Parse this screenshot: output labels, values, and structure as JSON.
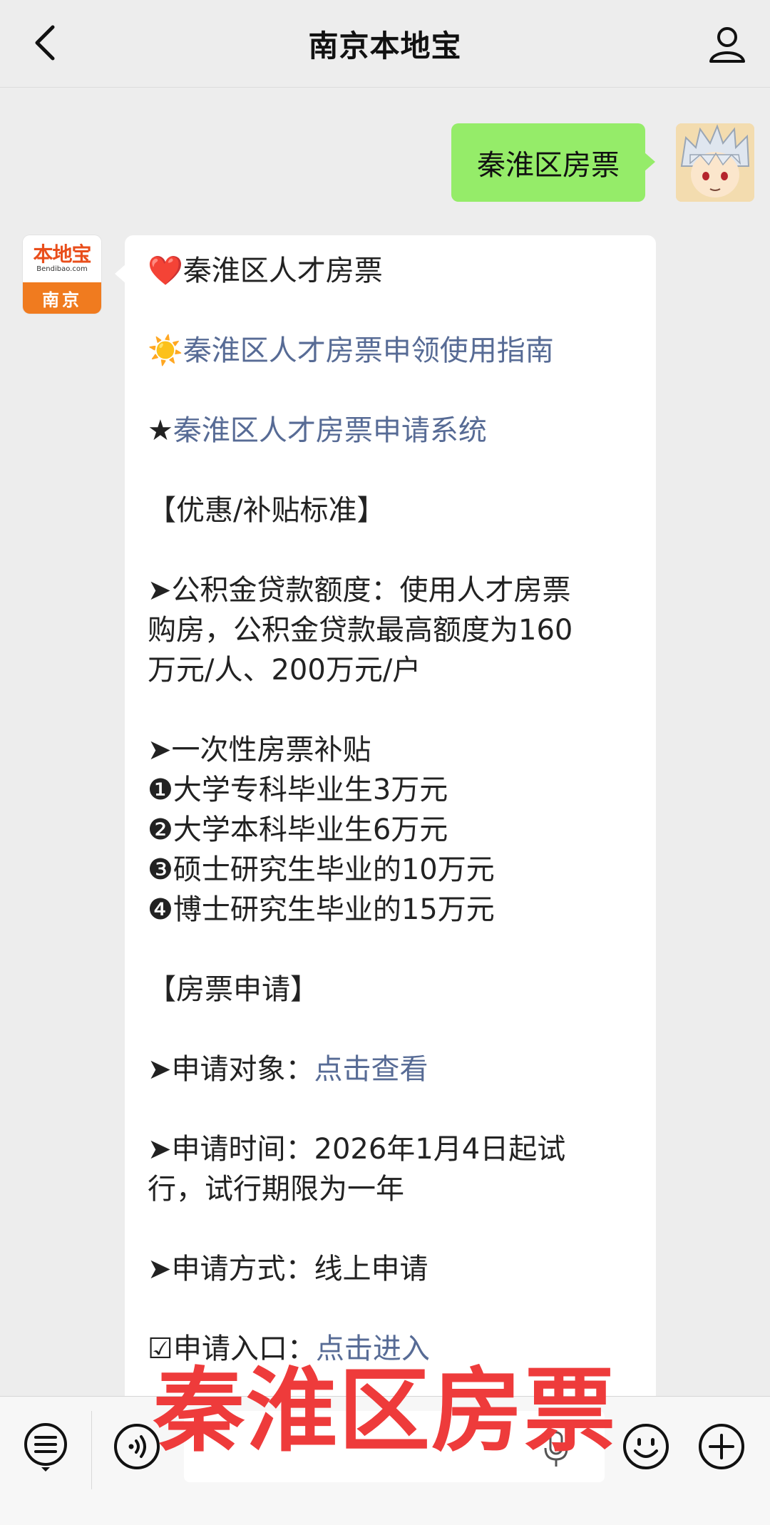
{
  "header": {
    "title": "南京本地宝",
    "back_icon": "chevron-left-icon",
    "profile_icon": "person-icon"
  },
  "user_message": {
    "text": "秦淮区房票"
  },
  "bot": {
    "logo_cn": "本地宝",
    "logo_en": "Bendibao.com",
    "logo_city": "南京"
  },
  "reply": {
    "l1_icon": "❤️",
    "l1_text": "秦淮区人才房票",
    "l2_icon": "☀️",
    "l2_link": "秦淮区人才房票申领使用指南",
    "l3_icon": "★",
    "l3_link": "秦淮区人才房票申请系统",
    "l4": "【优惠/补贴标准】",
    "l5": "➤公积金贷款额度：使用人才房票",
    "l6": "购房，公积金贷款最高额度为160",
    "l7": "万元/人、200万元/户",
    "l8": "➤一次性房票补贴",
    "l9": "❶大学专科毕业生3万元",
    "l10": "❷大学本科毕业生6万元",
    "l11": "❸硕士研究生毕业的10万元",
    "l12": "❹博士研究生毕业的15万元",
    "l13": "【房票申请】",
    "l14_prefix": "➤申请对象：",
    "l14_link": "点击查看",
    "l15": "➤申请时间：2026年1月4日起试",
    "l16": "行，试行期限为一年",
    "l17": "➤申请方式：线上申请",
    "l18_prefix": "☑申请入口：",
    "l18_link": "点击进入"
  },
  "overlay_text": "秦淮区房票",
  "inputbar": {
    "menu_icon": "menu-list-icon",
    "voice_icon": "voice-icon",
    "mic_icon": "mic-icon",
    "emoji_icon": "emoji-icon",
    "plus_icon": "plus-icon"
  },
  "colors": {
    "user_bubble": "#95ec69",
    "link": "#576b95",
    "overlay": "#ee3b3b"
  }
}
